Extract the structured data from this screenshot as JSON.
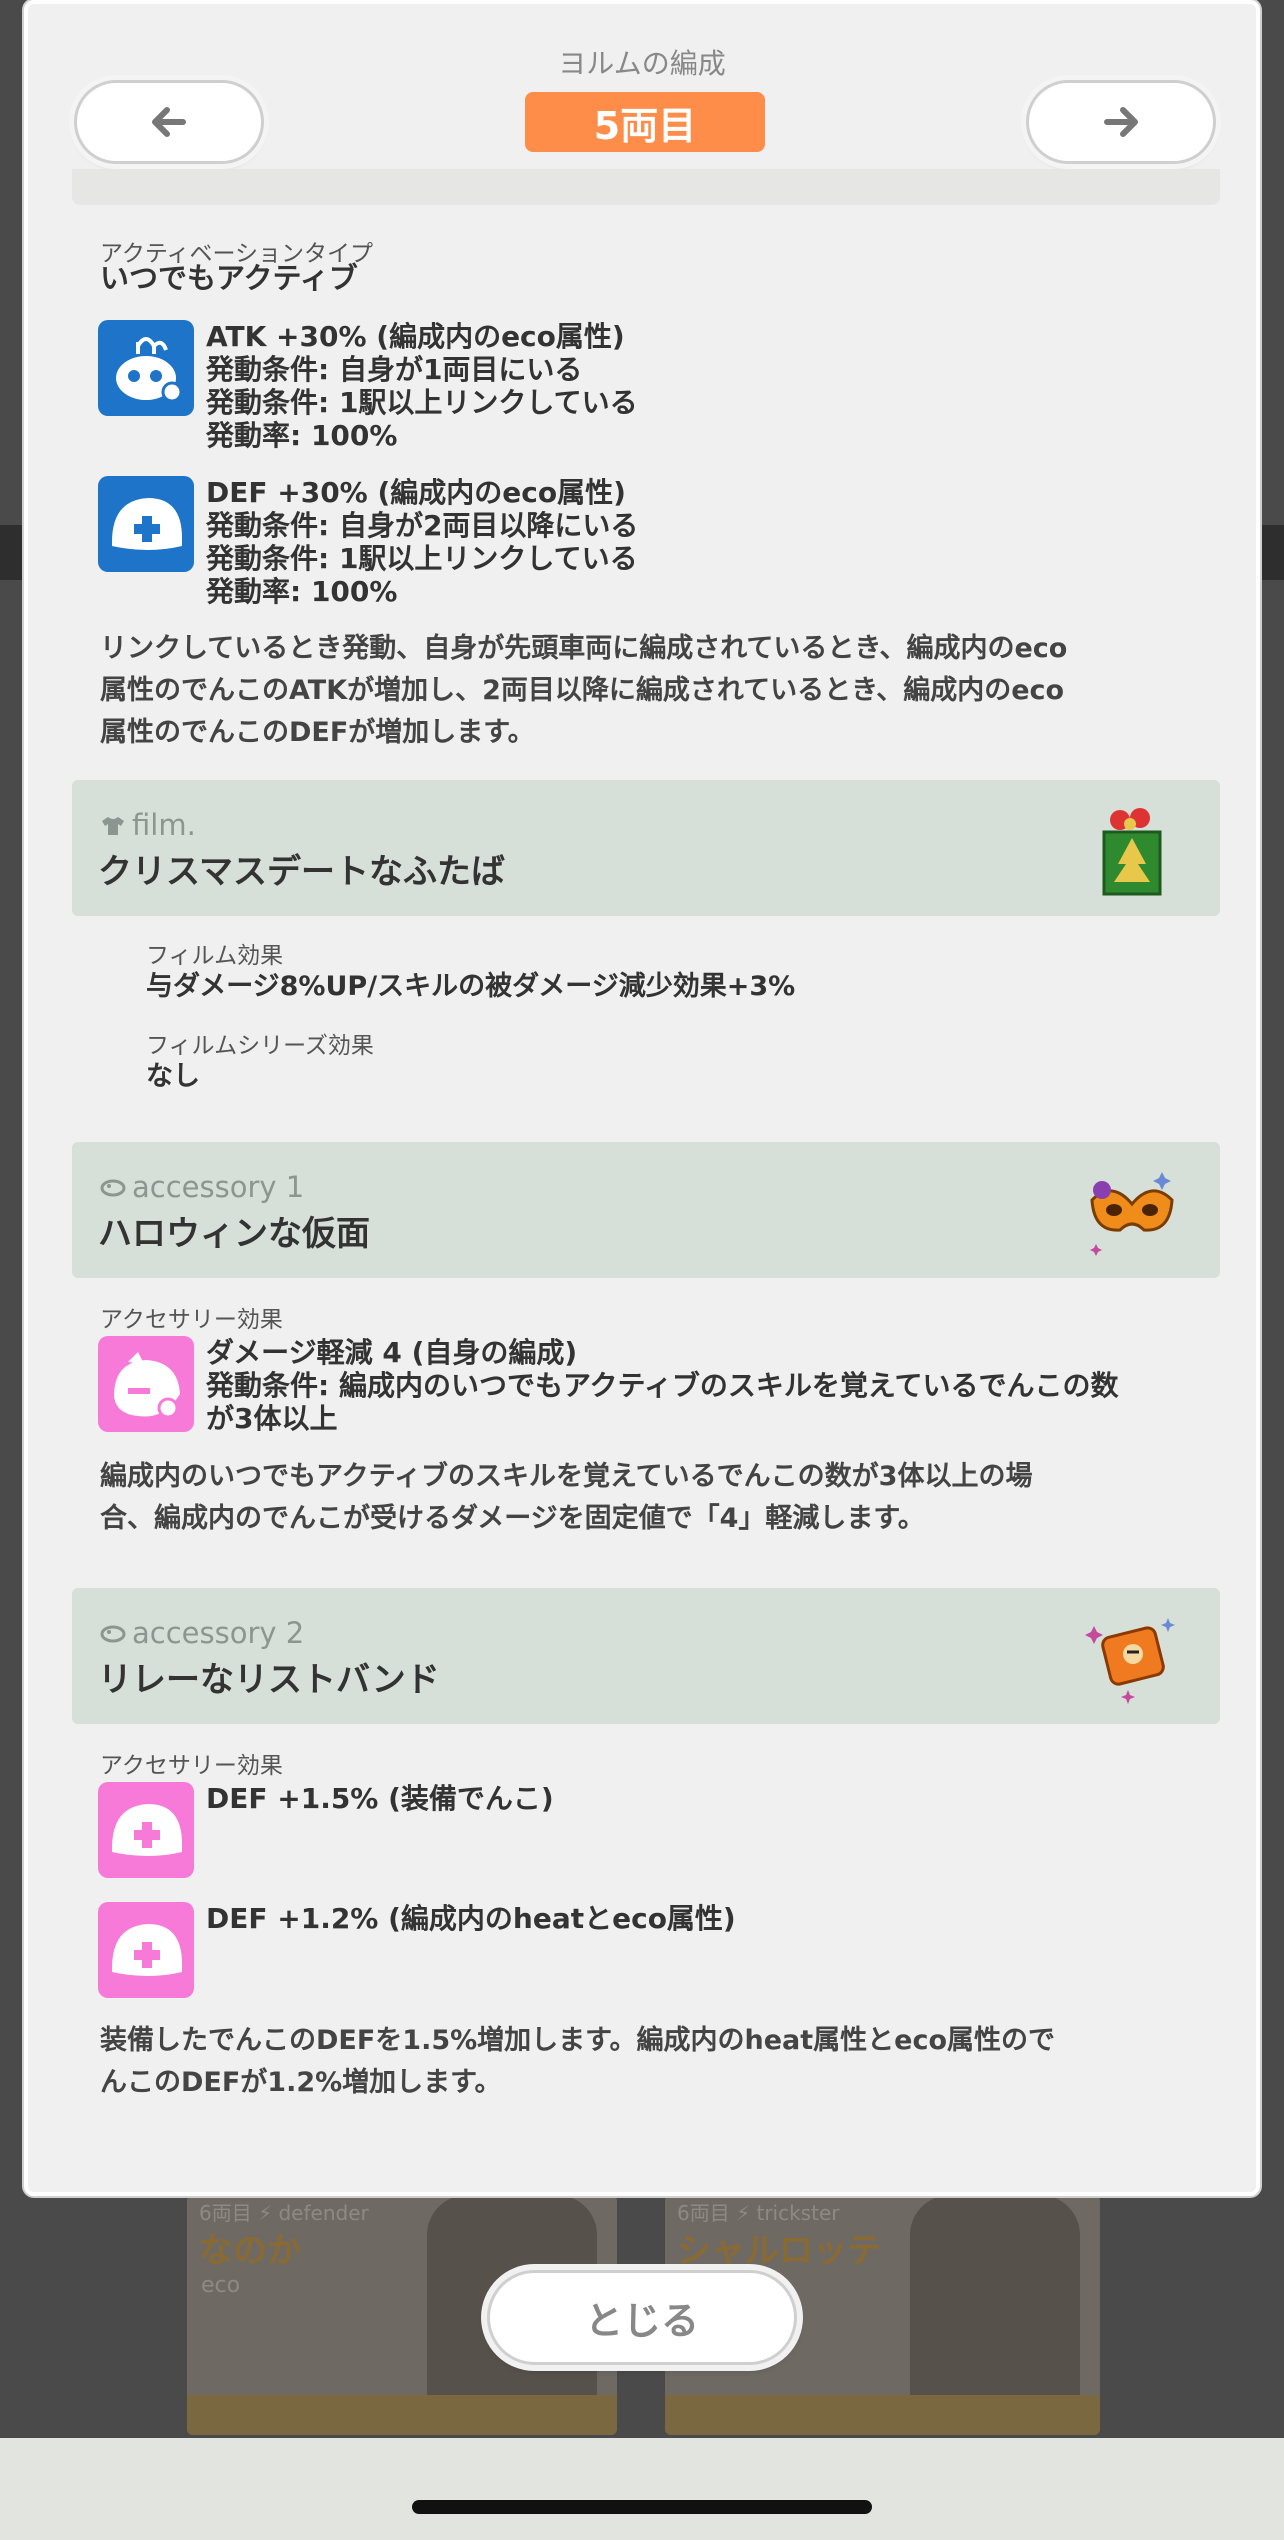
{
  "header": {
    "title": "ヨルムの編成",
    "car_number": "5両目"
  },
  "skill": {
    "activation_label": "アクティベーションタイプ",
    "activation_type": "いつでもアクティブ",
    "effects": [
      {
        "icon": "battery-robot-icon",
        "icon_color": "#1e74c8",
        "lines": [
          "ATK +30% (編成内のeco属性)",
          "発動条件: 自身が1両目にいる",
          "発動条件: 1駅以上リンクしている",
          "発動率: 100%"
        ]
      },
      {
        "icon": "helmet-icon",
        "icon_color": "#1e74c8",
        "lines": [
          "DEF +30% (編成内のeco属性)",
          "発動条件: 自身が2両目以降にいる",
          "発動条件: 1駅以上リンクしている",
          "発動率: 100%"
        ]
      }
    ],
    "description": [
      "リンクしているとき発動、自身が先頭車両に編成されているとき、編成内のeco",
      "属性のでんこのATKが増加し、2両目以降に編成されているとき、編成内のeco",
      "属性のでんこのDEFが増加します。"
    ]
  },
  "film": {
    "kind": "film.",
    "name": "クリスマスデートなふたば",
    "icon": "christmas-gift-bag-icon",
    "effect_label": "フィルム効果",
    "effect": "与ダメージ8%UP/スキルの被ダメージ減少効果+3%",
    "series_label": "フィルムシリーズ効果",
    "series_effect": "なし"
  },
  "accessory1": {
    "kind": "accessory 1",
    "name": "ハロウィンな仮面",
    "icon": "halloween-mask-icon",
    "effect_label": "アクセサリー効果",
    "effects": [
      {
        "icon": "shield-denko-icon",
        "icon_color": "#f77ad8",
        "lines": [
          "ダメージ軽減 4 (自身の編成)",
          "発動条件: 編成内のいつでもアクティブのスキルを覚えているでんこの数",
          "が3体以上"
        ]
      }
    ],
    "description": [
      "編成内のいつでもアクティブのスキルを覚えているでんこの数が3体以上の場",
      "合、編成内のでんこが受けるダメージを固定値で「4」軽減します。"
    ]
  },
  "accessory2": {
    "kind": "accessory 2",
    "name": "リレーなリストバンド",
    "icon": "wristband-icon",
    "effect_label": "アクセサリー効果",
    "effects": [
      {
        "icon": "helmet-icon",
        "icon_color": "#f77ad8",
        "lines": [
          "DEF +1.5% (装備でんこ)"
        ]
      },
      {
        "icon": "helmet-icon",
        "icon_color": "#f77ad8",
        "lines": [
          "DEF +1.2% (編成内のheatとeco属性)"
        ]
      }
    ],
    "description": [
      "装備したでんこのDEFを1.5%増加します。編成内のheat属性とeco属性ので",
      "んこのDEFが1.2%増加します。"
    ]
  },
  "background": {
    "cards": [
      {
        "meta": "6両目 ⚡ defender",
        "name": "なのか",
        "tag": "eco"
      },
      {
        "meta": "6両目 ⚡ trickster",
        "name": "シャルロッテ"
      }
    ]
  },
  "footer": {
    "close_label": "とじる"
  }
}
